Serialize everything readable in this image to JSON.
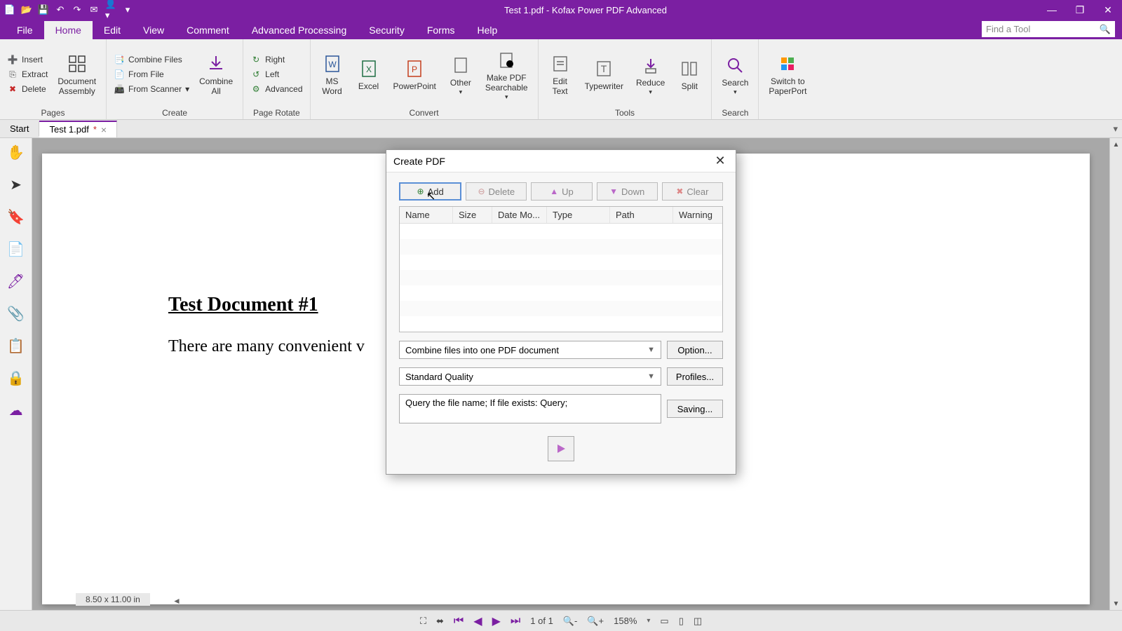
{
  "titlebar": {
    "title": "Test 1.pdf - Kofax Power PDF Advanced"
  },
  "menubar": {
    "tabs": [
      "File",
      "Home",
      "Edit",
      "View",
      "Comment",
      "Advanced Processing",
      "Security",
      "Forms",
      "Help"
    ],
    "search_placeholder": "Find a Tool"
  },
  "ribbon": {
    "pages": {
      "insert": "Insert",
      "extract": "Extract",
      "delete": "Delete",
      "assembly": "Document\nAssembly",
      "label": "Pages"
    },
    "create": {
      "combine_files": "Combine Files",
      "from_file": "From File",
      "from_scanner": "From Scanner",
      "combine_all": "Combine\nAll",
      "label": "Create"
    },
    "rotate": {
      "right": "Right",
      "left": "Left",
      "advanced": "Advanced",
      "label": "Page Rotate"
    },
    "convert": {
      "word": "MS\nWord",
      "excel": "Excel",
      "ppt": "PowerPoint",
      "other": "Other",
      "searchable": "Make PDF\nSearchable",
      "label": "Convert"
    },
    "tools": {
      "edit_text": "Edit\nText",
      "typewriter": "Typewriter",
      "reduce": "Reduce",
      "split": "Split",
      "label": "Tools"
    },
    "search": {
      "search": "Search",
      "label": "Search"
    },
    "paperport": {
      "btn": "Switch to\nPaperPort",
      "label": ""
    }
  },
  "doc_tabs": {
    "start": "Start",
    "file": "Test 1.pdf"
  },
  "page": {
    "heading": "Test Document #1",
    "body": "There are many convenient v",
    "dimensions": "8.50 x 11.00 in"
  },
  "statusbar": {
    "page": "1 of 1",
    "zoom": "158%"
  },
  "dialog": {
    "title": "Create PDF",
    "buttons": {
      "add": "Add",
      "delete": "Delete",
      "up": "Up",
      "down": "Down",
      "clear": "Clear"
    },
    "columns": {
      "name": "Name",
      "size": "Size",
      "date": "Date Mo...",
      "type": "Type",
      "path": "Path",
      "warning": "Warning"
    },
    "combine": "Combine files into one PDF document",
    "quality": "Standard Quality",
    "query": "Query the file name; If file exists: Query;",
    "option": "Option...",
    "profiles": "Profiles...",
    "saving": "Saving..."
  }
}
